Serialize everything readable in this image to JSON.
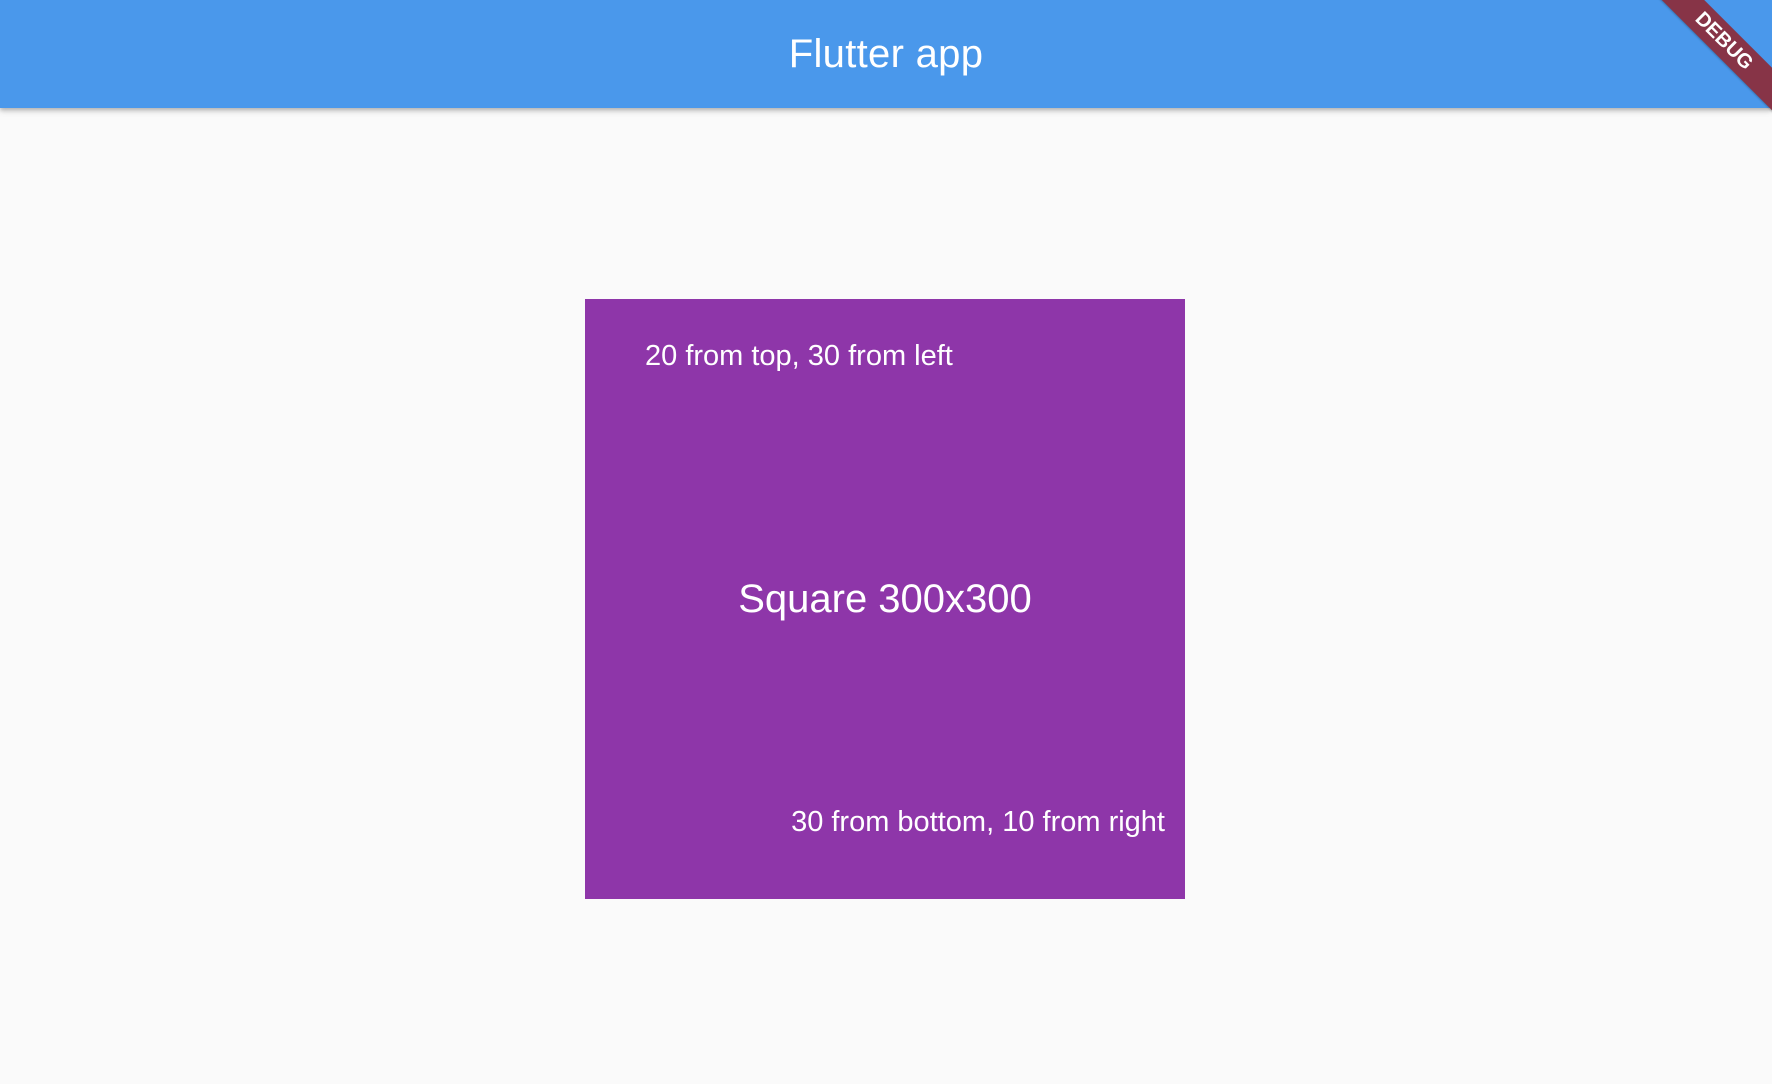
{
  "appbar": {
    "title": "Flutter app",
    "color": "#4a98eb"
  },
  "square": {
    "color": "#8e36a9",
    "top_left_label": "20 from top, 30 from left",
    "center_label": "Square 300x300",
    "bottom_right_label": "30 from bottom, 10 from right"
  },
  "debug_banner": {
    "label": "DEBUG",
    "color": "#873447"
  }
}
